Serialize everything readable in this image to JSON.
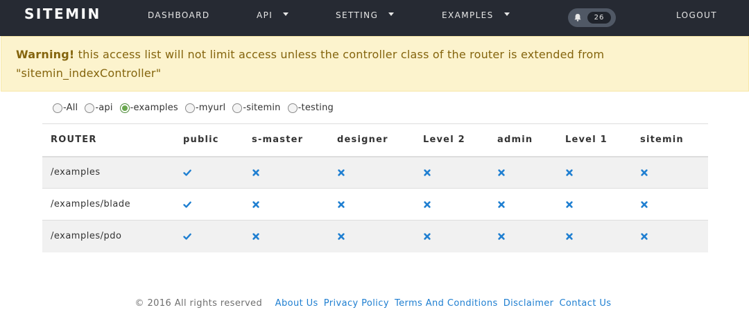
{
  "navbar": {
    "brand": "SITEMIN",
    "items": [
      {
        "label": "DASHBOARD",
        "has_dropdown": false
      },
      {
        "label": "API",
        "has_dropdown": true
      },
      {
        "label": "SETTING",
        "has_dropdown": true
      },
      {
        "label": "EXAMPLES",
        "has_dropdown": true
      }
    ],
    "notification_count": "26",
    "logout_label": "LOGOUT"
  },
  "alert": {
    "strong": "Warning!",
    "message": " this access list will not limit access unless the controller class of the router is extended from \"sitemin_indexController\""
  },
  "filters": [
    {
      "label": "-All",
      "checked": false
    },
    {
      "label": "-api",
      "checked": false
    },
    {
      "label": "-examples",
      "checked": true
    },
    {
      "label": "-myurl",
      "checked": false
    },
    {
      "label": "-sitemin",
      "checked": false
    },
    {
      "label": "-testing",
      "checked": false
    }
  ],
  "table": {
    "headers": [
      "ROUTER",
      "public",
      "s-master",
      "designer",
      "Level 2",
      "admin",
      "Level 1",
      "sitemin"
    ],
    "rows": [
      {
        "router": "/examples",
        "access": [
          "allowed",
          "denied",
          "denied",
          "denied",
          "denied",
          "denied",
          "denied"
        ]
      },
      {
        "router": "/examples/blade",
        "access": [
          "allowed",
          "denied",
          "denied",
          "denied",
          "denied",
          "denied",
          "denied"
        ]
      },
      {
        "router": "/examples/pdo",
        "access": [
          "allowed",
          "denied",
          "denied",
          "denied",
          "denied",
          "denied",
          "denied"
        ]
      }
    ]
  },
  "icons": {
    "allowed": "check-icon",
    "denied": "cross-icon",
    "notification": "bell-icon",
    "caret": "caret-down-icon"
  },
  "colors": {
    "navbar": "#262a33",
    "alert_bg": "#fcf3cd",
    "alert_text": "#84640d",
    "accent": "#1f7fd1"
  },
  "footer": {
    "copyright": "© 2016 All rights reserved",
    "links": [
      "About Us",
      "Privacy Policy",
      "Terms And Conditions",
      "Disclaimer",
      "Contact Us"
    ]
  }
}
